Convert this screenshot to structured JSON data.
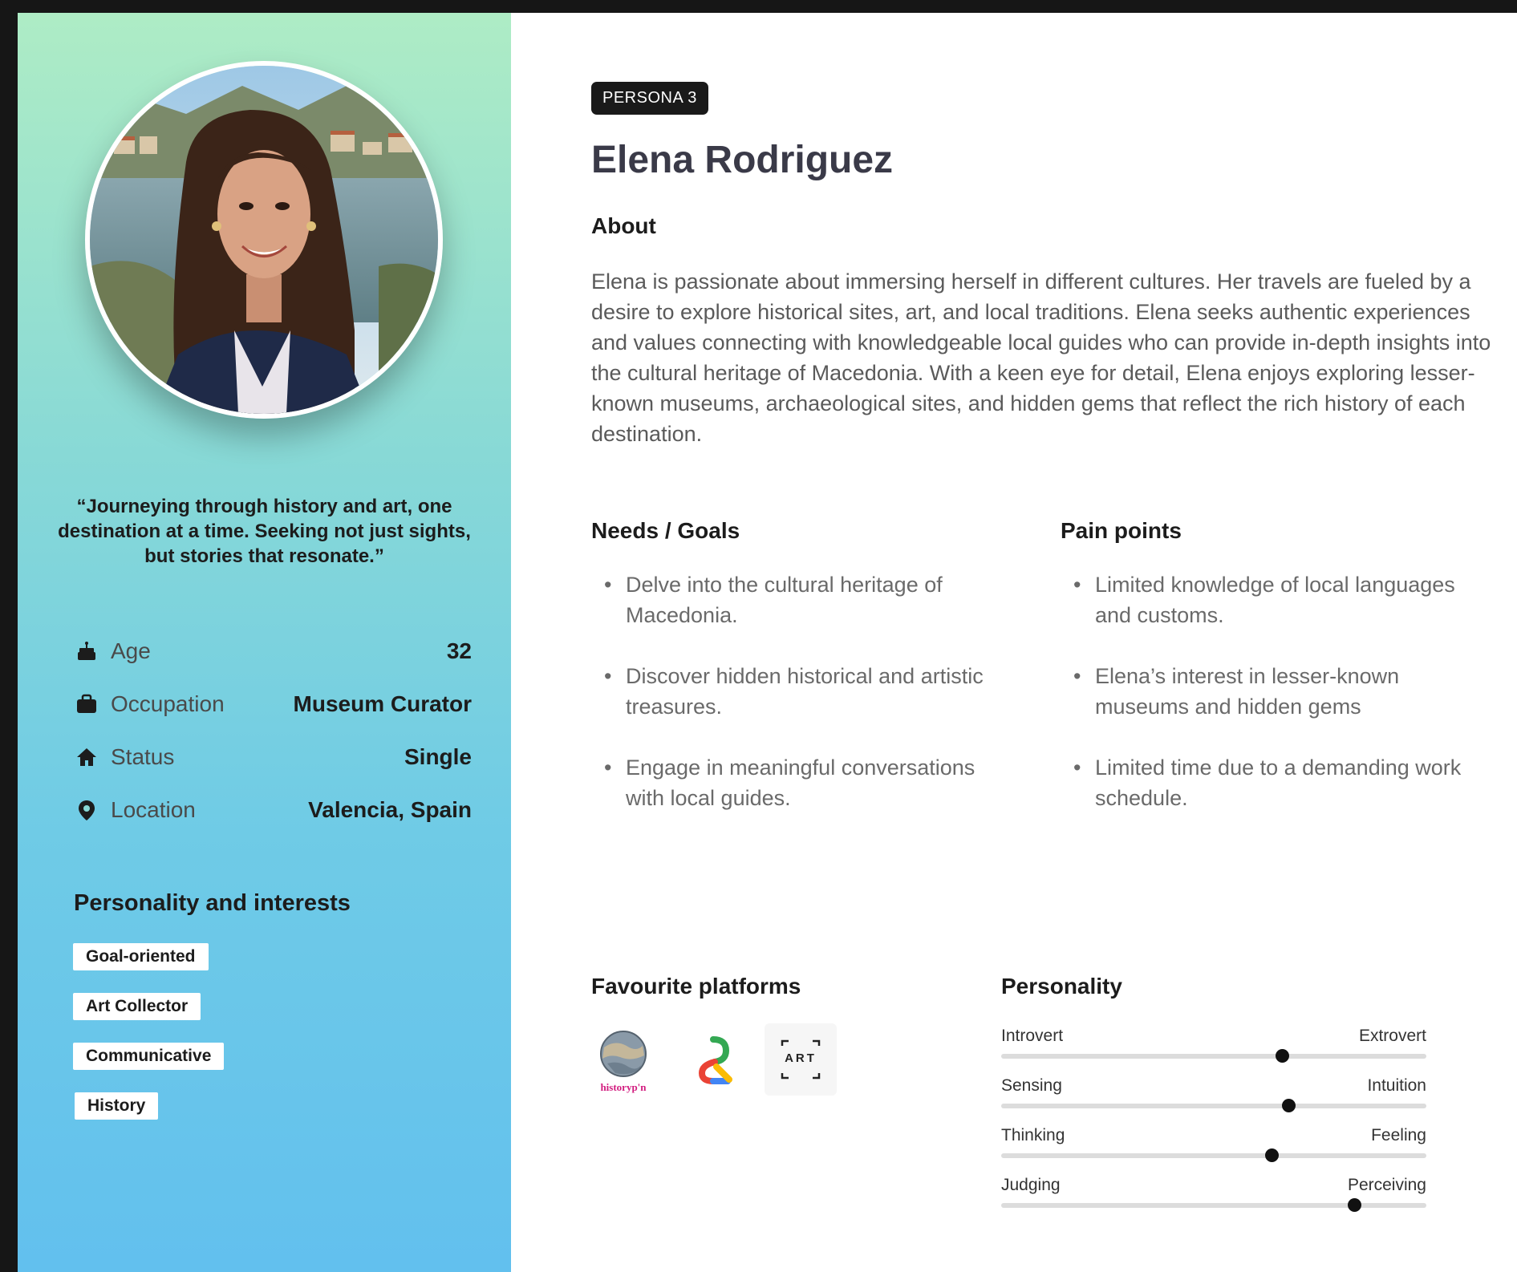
{
  "persona": {
    "badge": "PERSONA 3",
    "name": "Elena Rodriguez",
    "quote": "“Journeying through history and art, one destination at a time. Seeking not just sights, but stories that resonate.”"
  },
  "info": [
    {
      "icon": "cake-icon",
      "label": "Age",
      "value": "32"
    },
    {
      "icon": "briefcase-icon",
      "label": "Occupation",
      "value": "Museum Curator"
    },
    {
      "icon": "home-icon",
      "label": "Status",
      "value": "Single"
    },
    {
      "icon": "location-pin-icon",
      "label": "Location",
      "value": "Valencia, Spain"
    }
  ],
  "interests": {
    "title": "Personality and interests",
    "tags": [
      "Goal-oriented",
      "Art Collector",
      "Communicative",
      "History"
    ]
  },
  "about": {
    "title": "About",
    "text": "Elena is passionate about immersing herself in different cultures. Her travels are fueled by a desire to explore historical sites, art, and local traditions. Elena seeks authentic experiences and values connecting with knowledgeable local guides who can provide in-depth insights into the cultural heritage of Macedonia. With a keen eye for detail, Elena enjoys exploring lesser-known museums, archaeological sites, and hidden gems that reflect the rich history of each destination."
  },
  "needs": {
    "title": "Needs / Goals",
    "items": [
      "Delve into the cultural heritage of Macedonia.",
      "Discover hidden historical and artistic treasures.",
      "Engage in meaningful conversations with local guides."
    ]
  },
  "pain_points": {
    "title": "Pain points",
    "items": [
      "Limited knowledge of local languages and customs.",
      "Elena’s interest in lesser-known museums and hidden gems",
      "Limited time due to a demanding work schedule."
    ]
  },
  "platforms": {
    "title": "Favourite platforms",
    "items": [
      {
        "icon": "globe-logo-icon",
        "label": "historyp'n"
      },
      {
        "icon": "arts-culture-logo-icon",
        "label": ""
      },
      {
        "icon": "art-scanner-logo-icon",
        "label": "ART"
      }
    ]
  },
  "personality": {
    "title": "Personality",
    "traits": [
      {
        "left": "Introvert",
        "right": "Extrovert",
        "value": 0.66
      },
      {
        "left": "Sensing",
        "right": "Intuition",
        "value": 0.675
      },
      {
        "left": "Thinking",
        "right": "Feeling",
        "value": 0.635
      },
      {
        "left": "Judging",
        "right": "Perceiving",
        "value": 0.83
      }
    ]
  },
  "colors": {
    "gradient_top": "#aeecc5",
    "gradient_bottom": "#62c0ee",
    "badge_bg": "#1a1a1a",
    "name_color": "#3a3a48"
  }
}
